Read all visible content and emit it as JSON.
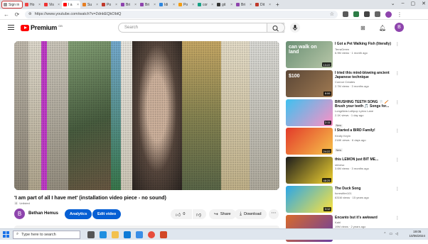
{
  "browser": {
    "profile_label": "Sign in",
    "tabs": [
      "Ho",
      "Vis",
      "I a",
      "Su",
      "Po",
      "Bri",
      "Bri",
      "Idi",
      "Po",
      "cor",
      "git",
      "Bri",
      "Dit"
    ],
    "url": "https://www.youtube.com/watch?v=2dnkEQkObtQ"
  },
  "youtube": {
    "logo_text": "Premium",
    "logo_sup": "GB",
    "search_placeholder": "Search",
    "avatar_letter": "B"
  },
  "video": {
    "title": "'I am part of all I have met' (installation video piece - no sound)",
    "unlisted_label": "Unlisted",
    "channel_avatar_letter": "B",
    "channel_name": "Bethan Hemus",
    "analytics_label": "Analytics",
    "edit_label": "Edit video",
    "like_count": "0",
    "share_label": "Share",
    "download_label": "Download"
  },
  "recommendations": [
    {
      "title": "I Got a Pet Walking Fish (literally)",
      "channel": "TerraGreen",
      "meta": "6.9M views · 1 month ago",
      "duration": "13:22",
      "new": "",
      "thumb_text": "can walk on land",
      "colors": [
        "#6a8f74",
        "#b8c7a8"
      ]
    },
    {
      "title": "I tried this mind-blowing ancient Japanese technique",
      "channel": "Connor Creates",
      "meta": "2.7M views · 3 months ago",
      "duration": "8:06",
      "new": "",
      "thumb_text": "$100",
      "colors": [
        "#5a4636",
        "#a07a52"
      ]
    },
    {
      "title": "BRUSHING TEETH SONG 🦷 🪥 Brush your teeth 🎵 Songs for...",
      "channel": "LongAlida Lollipop Lyrics Lane",
      "meta": "2.1K views · 1 day ago",
      "duration": "2:11",
      "new": "New",
      "thumb_text": "",
      "colors": [
        "#3ec1f0",
        "#ff8fc4"
      ]
    },
    {
      "title": "I Started a BIRD Family!",
      "channel": "Kindly Keyin",
      "meta": "218K views · 6 days ago",
      "duration": "24:22",
      "new": "New",
      "thumb_text": "",
      "colors": [
        "#e23a2a",
        "#f7c34a"
      ]
    },
    {
      "title": "this LEMON just BIT ME...",
      "channel": "shivesz",
      "meta": "3.6M views · 3 months ago",
      "duration": "48:25",
      "new": "",
      "thumb_text": "",
      "colors": [
        "#1c1c1c",
        "#f2d230"
      ]
    },
    {
      "title": "The Duck Song",
      "channel": "forrestfire101",
      "meta": "631M views · 15 years ago",
      "duration": "3:12",
      "new": "",
      "thumb_text": "",
      "colors": [
        "#2aa6e8",
        "#ffe33b"
      ]
    },
    {
      "title": "Encanto but it's awkward",
      "channel": "Kahl",
      "meta": "19M views · 2 years ago",
      "duration": "",
      "new": "",
      "thumb_text": "",
      "colors": [
        "#d86a2b",
        "#6b3fa0"
      ]
    }
  ],
  "taskbar": {
    "search_placeholder": "Type here to search",
    "time": "19:05",
    "date": "10/06/2024"
  },
  "colors": {
    "youtube_red": "#ff0000",
    "accent_blue": "#065fd4",
    "avatar_purple": "#8e44ad"
  }
}
